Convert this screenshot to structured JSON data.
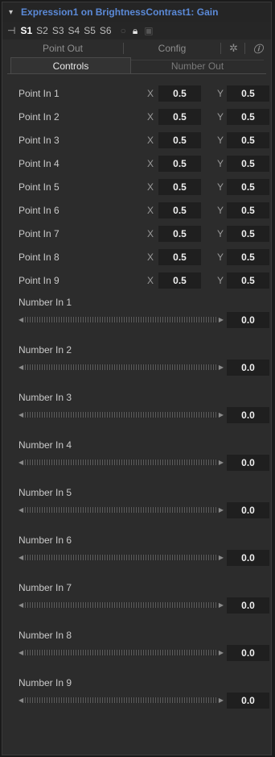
{
  "header": {
    "title": "Expression1 on BrightnessContrast1: Gain",
    "versions": [
      "S1",
      "S2",
      "S3",
      "S4",
      "S5",
      "S6"
    ],
    "active_version": "S1"
  },
  "tabs": {
    "row1": [
      "Point Out",
      "Config"
    ],
    "row2": [
      "Controls",
      "Number Out"
    ],
    "active": "Controls"
  },
  "axis": {
    "x": "X",
    "y": "Y"
  },
  "points": [
    {
      "label": "Point In 1",
      "x": "0.5",
      "y": "0.5"
    },
    {
      "label": "Point In 2",
      "x": "0.5",
      "y": "0.5"
    },
    {
      "label": "Point In 3",
      "x": "0.5",
      "y": "0.5"
    },
    {
      "label": "Point In 4",
      "x": "0.5",
      "y": "0.5"
    },
    {
      "label": "Point In 5",
      "x": "0.5",
      "y": "0.5"
    },
    {
      "label": "Point In 6",
      "x": "0.5",
      "y": "0.5"
    },
    {
      "label": "Point In 7",
      "x": "0.5",
      "y": "0.5"
    },
    {
      "label": "Point In 8",
      "x": "0.5",
      "y": "0.5"
    },
    {
      "label": "Point In 9",
      "x": "0.5",
      "y": "0.5"
    }
  ],
  "numbers": [
    {
      "label": "Number In 1",
      "value": "0.0"
    },
    {
      "label": "Number In 2",
      "value": "0.0"
    },
    {
      "label": "Number In 3",
      "value": "0.0"
    },
    {
      "label": "Number In 4",
      "value": "0.0"
    },
    {
      "label": "Number In 5",
      "value": "0.0"
    },
    {
      "label": "Number In 6",
      "value": "0.0"
    },
    {
      "label": "Number In 7",
      "value": "0.0"
    },
    {
      "label": "Number In 8",
      "value": "0.0"
    },
    {
      "label": "Number In 9",
      "value": "0.0"
    }
  ],
  "colors": {
    "title": "#5b8ad8",
    "panel_bg": "#2c2c2c",
    "field_bg": "#1f1f1f"
  },
  "icons": [
    "chevron-down-icon",
    "pin-icon",
    "circle-icon",
    "lock-icon",
    "save-icon",
    "gear-icon",
    "info-icon",
    "left-arrow-icon",
    "right-arrow-icon"
  ]
}
